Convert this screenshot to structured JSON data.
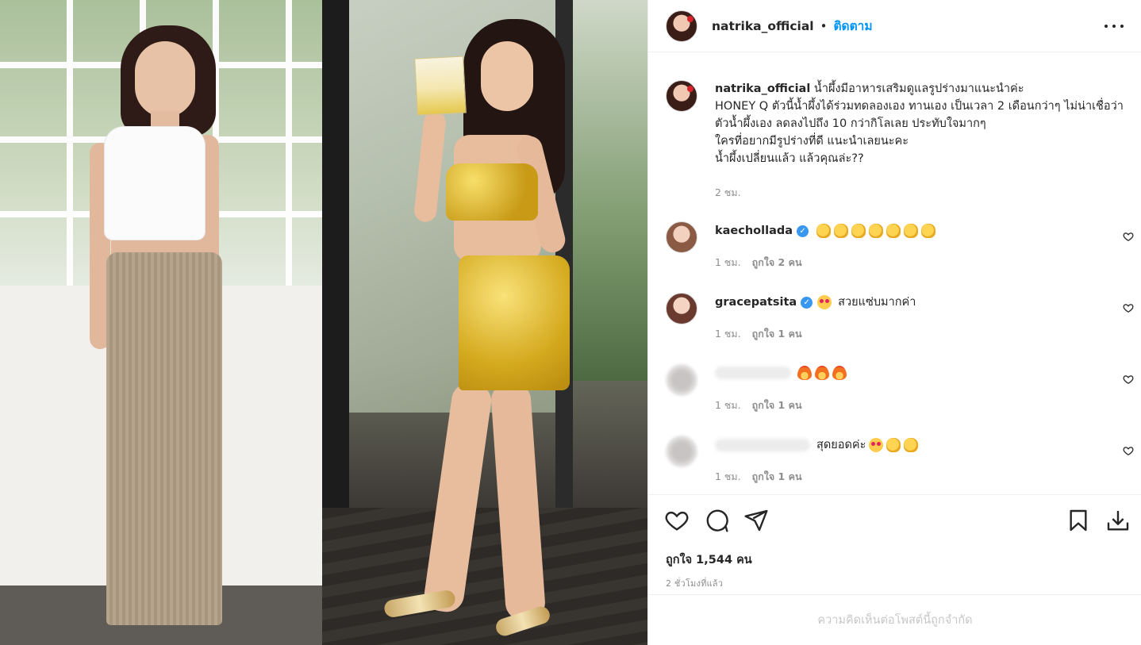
{
  "post": {
    "username": "natrika_official",
    "separator": "•",
    "follow_label": "ติดตาม",
    "caption_user": "natrika_official",
    "caption_text": " น้ำผึ้งมีอาหารเสริมดูแลรูปร่างมาแนะนำค่ะ\nHONEY Q ตัวนี้น้ำผึ้งได้ร่วมทดลองเอง ทานเอง เป็นเวลา 2 เดือนกว่าๆ ไม่น่าเชื่อว่าตัวน้ำผึ้งเอง ลดลงไปถึง 10 กว่ากิโลเลย ประทับใจมากๆ\nใครที่อยากมีรูปร่างที่ดี แนะนำเลยนะคะ\nน้ำผึ้งเปลี่ยนแล้ว แล้วคุณล่ะ??",
    "caption_time": "2 ชม.",
    "likes_total": "ถูกใจ 1,544 คน",
    "post_time": "2 ชั่วโมงที่แล้ว",
    "comments_limited": "ความคิดเห็นต่อโพสต์นี้ถูกจำกัด"
  },
  "comments": [
    {
      "user": "kaechollada",
      "verified": true,
      "text": "",
      "emoji": [
        "clap",
        "clap",
        "clap",
        "clap",
        "clap",
        "clap",
        "clap"
      ],
      "time": "1 ชม.",
      "likes": "ถูกใจ 2 คน"
    },
    {
      "user": "gracepatsita",
      "verified": true,
      "text": "สวยแซ่บมากค่า",
      "emoji_before": [
        "heart-eyes"
      ],
      "time": "1 ชม.",
      "likes": "ถูกใจ 1 คน"
    },
    {
      "user": "",
      "verified": false,
      "blurred": true,
      "text": "",
      "emoji": [
        "fire",
        "fire",
        "fire"
      ],
      "time": "1 ชม.",
      "likes": "ถูกใจ 1 คน"
    },
    {
      "user": "",
      "verified": false,
      "blurred": true,
      "text": "สุดยอดค่ะ",
      "emoji": [
        "heart-eyes",
        "clap",
        "clap"
      ],
      "time": "1 ชม.",
      "likes": "ถูกใจ 1 คน"
    }
  ],
  "icons": {
    "more": "more-dots-icon",
    "like": "heart-icon",
    "comment": "comment-bubble-icon",
    "share": "paper-plane-icon",
    "save": "bookmark-icon",
    "download": "download-icon",
    "comment_like": "small-heart-icon"
  },
  "colors": {
    "accent": "#0095f6",
    "text": "#262626",
    "muted": "#8e8e8e",
    "border": "#efefef",
    "verified": "#3897f0"
  }
}
